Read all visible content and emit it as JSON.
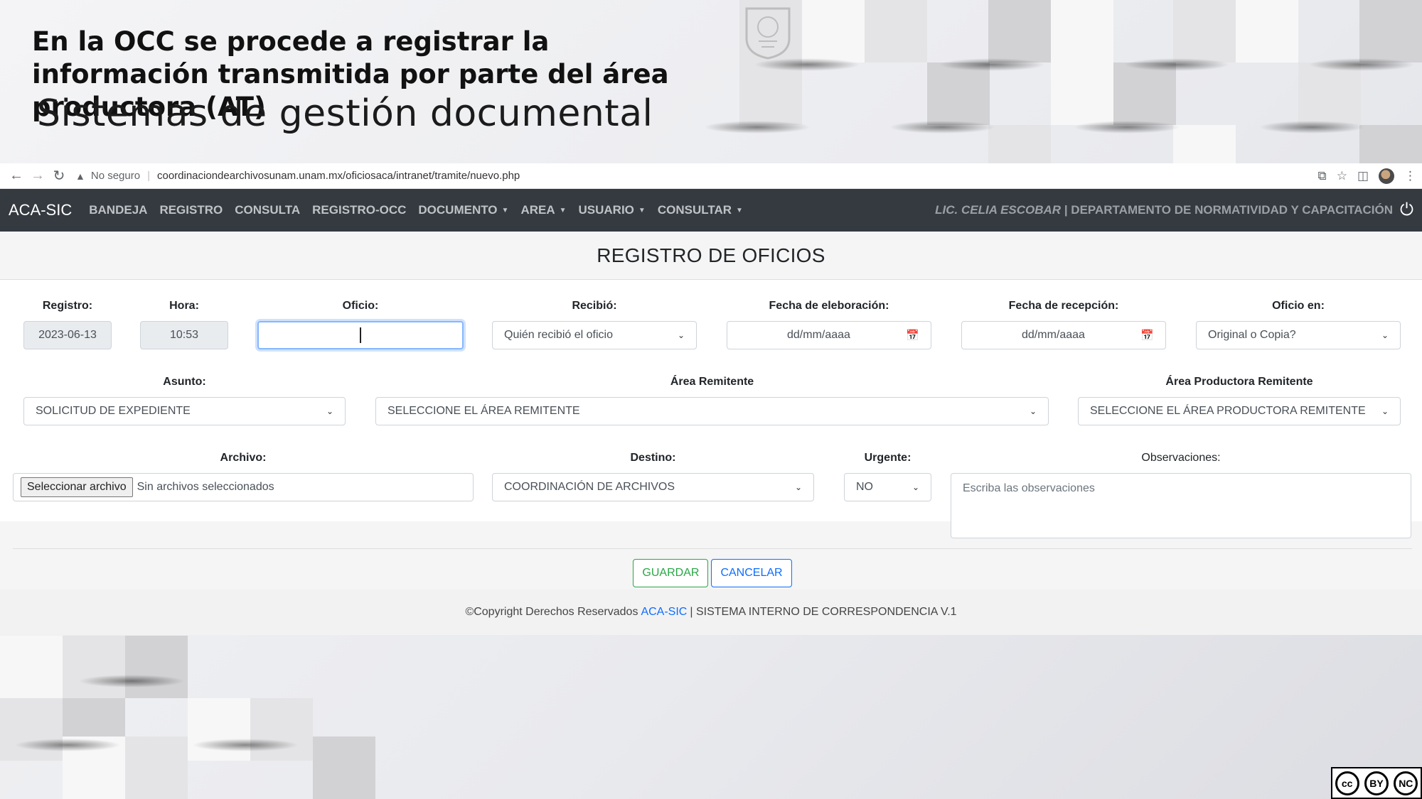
{
  "slide": {
    "title": "En la OCC se procede a registrar la información transmitida por parte del área productora (AT)",
    "subtitle": "Sistemas de gestión documental"
  },
  "browser": {
    "security_label": "No seguro",
    "url": "coordinaciondearchivosunam.unam.mx/oficiosaca/intranet/tramite/nuevo.php"
  },
  "navbar": {
    "brand": "ACA-SIC",
    "items": [
      {
        "label": "BANDEJA",
        "dropdown": false
      },
      {
        "label": "REGISTRO",
        "dropdown": false
      },
      {
        "label": "CONSULTA",
        "dropdown": false
      },
      {
        "label": "REGISTRO-OCC",
        "dropdown": false
      },
      {
        "label": "DOCUMENTO",
        "dropdown": true
      },
      {
        "label": "AREA",
        "dropdown": true
      },
      {
        "label": "USUARIO",
        "dropdown": true
      },
      {
        "label": "CONSULTAR",
        "dropdown": true
      }
    ],
    "user_name": "LIC. CELIA ESCOBAR",
    "user_dept": "| DEPARTAMENTO DE NORMATIVIDAD Y CAPACITACIÓN"
  },
  "page": {
    "title": "REGISTRO DE OFICIOS"
  },
  "form": {
    "registro": {
      "label": "Registro:",
      "value": "2023-06-13"
    },
    "hora": {
      "label": "Hora:",
      "value": "10:53"
    },
    "oficio": {
      "label": "Oficio:",
      "value": ""
    },
    "recibio": {
      "label": "Recibió:",
      "value": "Quién recibió el oficio"
    },
    "fecha_elaboracion": {
      "label": "Fecha de eleboración:",
      "value": "dd/mm/aaaa"
    },
    "fecha_recepcion": {
      "label": "Fecha de recepción:",
      "value": "dd/mm/aaaa"
    },
    "oficio_en": {
      "label": "Oficio en:",
      "value": "Original o Copia?"
    },
    "asunto": {
      "label": "Asunto:",
      "value": "SOLICITUD DE EXPEDIENTE"
    },
    "area_remitente": {
      "label": "Área Remitente",
      "value": "SELECCIONE EL ÁREA REMITENTE"
    },
    "area_productora": {
      "label": "Área Productora Remitente",
      "value": "SELECCIONE EL ÁREA PRODUCTORA REMITENTE"
    },
    "archivo": {
      "label": "Archivo:",
      "button": "Seleccionar archivo",
      "status": "Sin archivos seleccionados"
    },
    "destino": {
      "label": "Destino:",
      "value": "COORDINACIÓN DE ARCHIVOS"
    },
    "urgente": {
      "label": "Urgente:",
      "value": "NO"
    },
    "observaciones": {
      "label": "Observaciones:",
      "placeholder": "Escriba las observaciones"
    }
  },
  "actions": {
    "save": "GUARDAR",
    "cancel": "CANCELAR"
  },
  "footer": {
    "prefix": "©Copyright Derechos Reservados",
    "link": "ACA-SIC",
    "suffix": "| SISTEMA INTERNO DE CORRESPONDENCIA V.1"
  },
  "license": {
    "cc": "cc",
    "by": "BY",
    "nc": "NC"
  }
}
